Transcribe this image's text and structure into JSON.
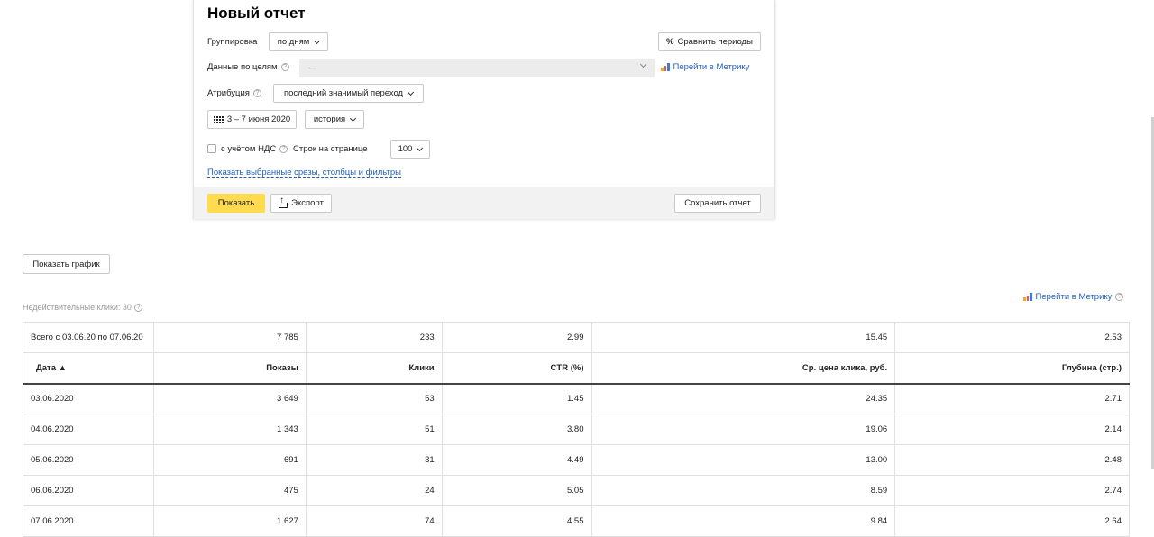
{
  "report": {
    "title": "Новый отчет",
    "grouping_label": "Группировка",
    "grouping_value": "по дням",
    "compare_periods": "Сравнить периоды",
    "compare_icon": "percent-icon",
    "goals_label": "Данные по целям",
    "goals_value": "—",
    "go_to_metrika": "Перейти в Метрику",
    "attribution_label": "Атрибуция",
    "attribution_value": "последний значимый переход",
    "date_range": "3 – 7 июня 2020",
    "history_value": "история",
    "vat_label": "с учётом НДС",
    "rows_per_page_label": "Строк на странице",
    "rows_per_page_value": "100",
    "show_cuts_link": "Показать выбранные срезы, столбцы и фильтры",
    "show_button": "Показать",
    "export_button": "Экспорт",
    "save_button": "Сохранить отчет"
  },
  "show_chart_button": "Показать график",
  "invalid_clicks": "Недействительные клики: 30",
  "go_to_metrika_right": "Перейти в Метрику",
  "colors": {
    "accent_yellow": "#ffdb4d",
    "link_blue": "#1f5fbf",
    "footer_gray": "#f2f2f2"
  },
  "table": {
    "totals": [
      "Всего с 03.06.20 по 07.06.20",
      "7 785",
      "233",
      "2.99",
      "15.45",
      "2.53"
    ],
    "headers": [
      "Дата ▲",
      "Показы",
      "Клики",
      "CTR (%)",
      "Ср. цена клика, руб.",
      "Глубина (стр.)"
    ],
    "rows": [
      [
        "03.06.2020",
        "3 649",
        "53",
        "1.45",
        "24.35",
        "2.71"
      ],
      [
        "04.06.2020",
        "1 343",
        "51",
        "3.80",
        "19.06",
        "2.14"
      ],
      [
        "05.06.2020",
        "691",
        "31",
        "4.49",
        "13.00",
        "2.48"
      ],
      [
        "06.06.2020",
        "475",
        "24",
        "5.05",
        "8.59",
        "2.74"
      ],
      [
        "07.06.2020",
        "1 627",
        "74",
        "4.55",
        "9.84",
        "2.64"
      ]
    ]
  }
}
